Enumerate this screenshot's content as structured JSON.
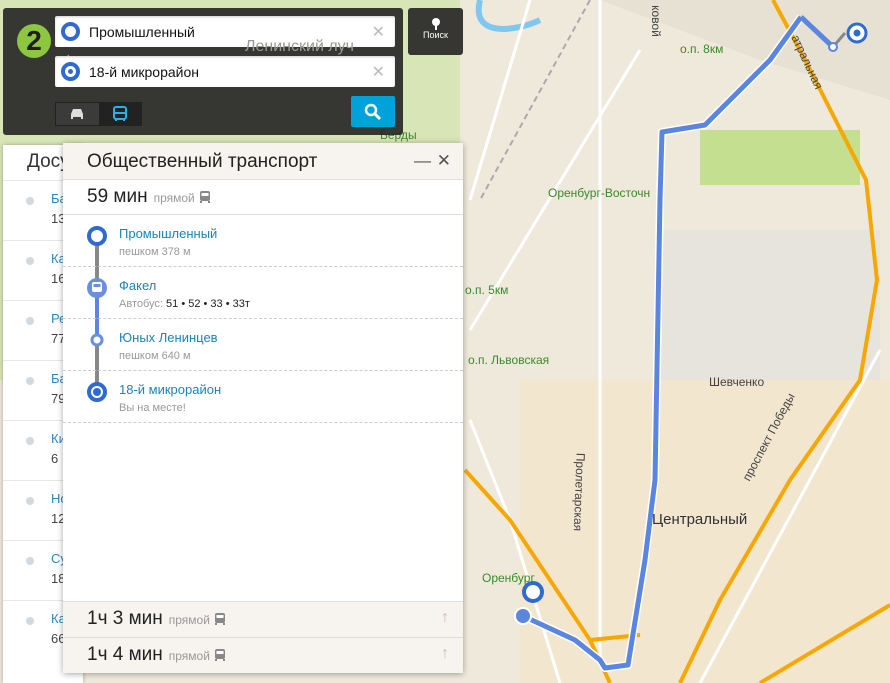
{
  "search": {
    "from": "Промышленный",
    "to": "18-й микрорайон",
    "poisk_label": "Поиск",
    "modes": [
      "car",
      "bus"
    ],
    "active_mode": "bus"
  },
  "logo": "2",
  "list": {
    "title": "Досу",
    "items": [
      {
        "name": "Ба",
        "sub": "13"
      },
      {
        "name": "Ка",
        "sub": "16"
      },
      {
        "name": "Ре",
        "sub": "77"
      },
      {
        "name": "Ба",
        "sub": "79"
      },
      {
        "name": "Ки",
        "sub": "6"
      },
      {
        "name": "Но",
        "sub": "12"
      },
      {
        "name": "Су",
        "sub": "18"
      },
      {
        "name": "Ка",
        "sub": "66"
      }
    ]
  },
  "transport": {
    "title": "Общественный транспорт",
    "best": {
      "time": "59 мин",
      "kind": "прямой"
    },
    "steps": [
      {
        "title": "Промышленный",
        "sub": "пешком 378 м"
      },
      {
        "title": "Факел",
        "sub_label": "Автобус:",
        "routes": "51 • 52 • 33 • 33т"
      },
      {
        "title": "Юных Ленинцев",
        "sub": "пешком 640 м"
      },
      {
        "title": "18-й микрорайон",
        "sub": "Вы на месте!"
      }
    ],
    "alternatives": [
      {
        "time": "1ч 3 мин",
        "kind": "прямой"
      },
      {
        "time": "1ч 4 мин",
        "kind": "прямой"
      }
    ]
  },
  "map": {
    "labels": {
      "l1": "Ленинский луч",
      "l2": "Берды",
      "l3": "о.п. 8км",
      "l4": "Оренбург-Восточн",
      "l5": "о.п. 5км",
      "l6": "о.п. Львовская",
      "l7": "Шевченко",
      "l8": "Центральный",
      "l9": "Оренбург",
      "l10": "Пролетарская",
      "l11": "проспект Победы",
      "l12": "атральная",
      "l13": "ковой"
    }
  },
  "colors": {
    "route": "#5b86e0",
    "accent": "#00a3d9",
    "highway": "#f7a800",
    "marker": "#2e6bd0"
  }
}
